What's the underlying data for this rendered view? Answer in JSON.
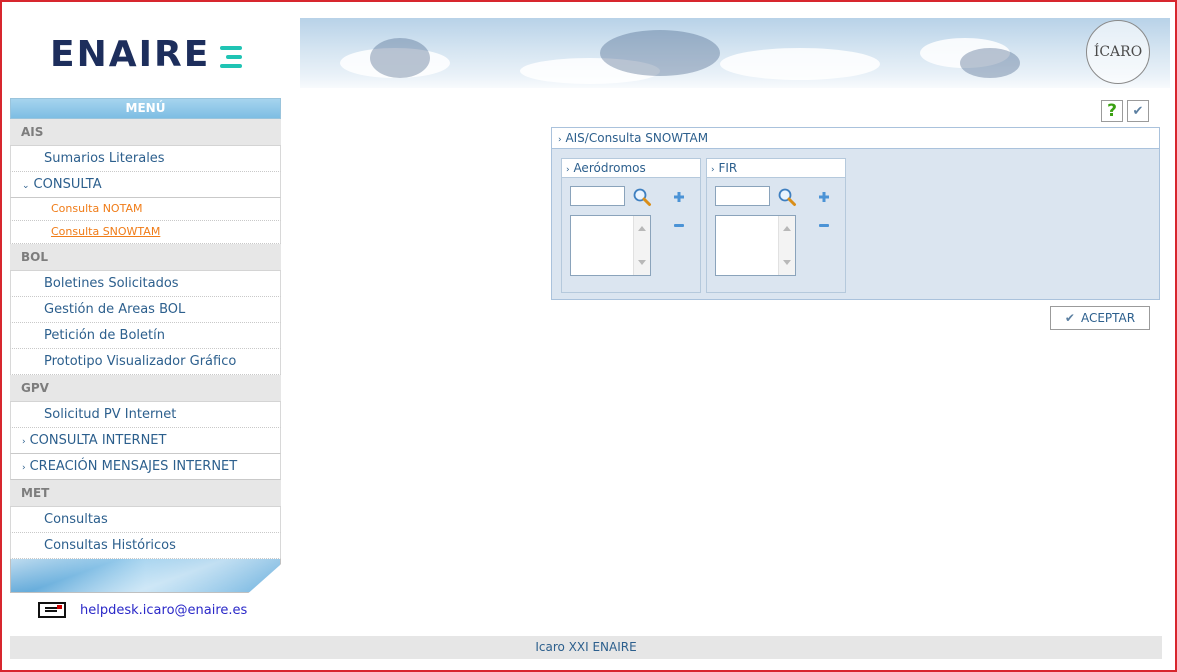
{
  "header": {
    "logo_left": "ENAIRE",
    "logo_right": "ÍCARO"
  },
  "sidebar": {
    "title": "MENÚ",
    "sections": [
      {
        "label": "AIS"
      },
      {
        "label": "BOL"
      },
      {
        "label": "GPV"
      },
      {
        "label": "MET"
      }
    ],
    "ais": {
      "sumarios": "Sumarios Literales",
      "consulta": "CONSULTA",
      "consulta_notam": "Consulta NOTAM",
      "consulta_snowtam": "Consulta SNOWTAM"
    },
    "bol": {
      "boletines": "Boletines Solicitados",
      "gestion": "Gestión de Areas BOL",
      "peticion": "Petición de Boletín",
      "prototipo": "Prototipo Visualizador Gráfico"
    },
    "gpv": {
      "solicitud": "Solicitud PV Internet",
      "consulta_internet": "CONSULTA INTERNET",
      "creacion": "CREACIÓN MENSAJES INTERNET"
    },
    "met": {
      "consultas": "Consultas",
      "historicos": "Consultas Históricos"
    }
  },
  "help": {
    "email": "helpdesk.icaro@enaire.es"
  },
  "main": {
    "panel_title": "AIS/Consulta SNOWTAM",
    "aerodromos": {
      "title": "Aeródromos",
      "input_value": ""
    },
    "fir": {
      "title": "FIR",
      "input_value": ""
    },
    "accept_label": "ACEPTAR"
  },
  "footer": {
    "text": "Icaro XXI ENAIRE"
  },
  "icons": {
    "help": "help-icon",
    "check": "check-icon",
    "search": "search-icon",
    "add": "add-icon",
    "remove": "remove-icon",
    "mail": "mail-icon"
  },
  "colors": {
    "frame_border": "#d7262e",
    "link": "#2c5f8d",
    "submenu": "#f07c18",
    "panel_bg": "#dbe5f0",
    "help_green": "#3aa012"
  }
}
